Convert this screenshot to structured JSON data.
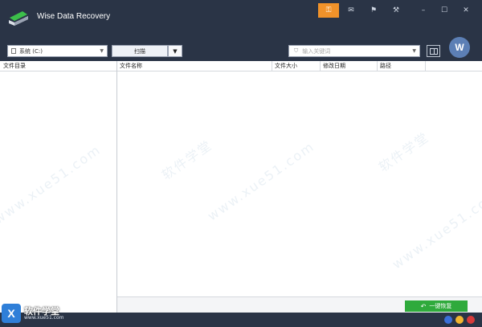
{
  "app": {
    "title": "Wise Data Recovery"
  },
  "window_buttons": [
    {
      "name": "key-icon",
      "glyph": "⚿"
    },
    {
      "name": "mail-icon",
      "glyph": "✉"
    },
    {
      "name": "feedback-icon",
      "glyph": "⚑"
    },
    {
      "name": "settings-icon",
      "glyph": "⚒"
    },
    {
      "name": "minimize-icon",
      "glyph": "–"
    },
    {
      "name": "maximize-icon",
      "glyph": "☐"
    },
    {
      "name": "close-icon",
      "glyph": "✕"
    }
  ],
  "toolbar": {
    "drive_value": "系统 (C:)",
    "scan_label": "扫描",
    "search_placeholder": "输入关键词",
    "avatar_letter": "W"
  },
  "left_panel": {
    "header": "文件目录"
  },
  "table": {
    "columns": [
      "文件名称",
      "文件大小",
      "修改日期",
      "路径"
    ]
  },
  "footer": {
    "recover_label": "一键恢复"
  },
  "watermark": {
    "brand_cn": "软件学堂",
    "brand_url": "www.xue51.com",
    "diag_text": "www.xue51.com",
    "diag_cn": "软件学堂"
  },
  "colors": {
    "titlebar": "#2a3446",
    "accent_orange": "#f0922a",
    "recover_green": "#2faa3c"
  }
}
